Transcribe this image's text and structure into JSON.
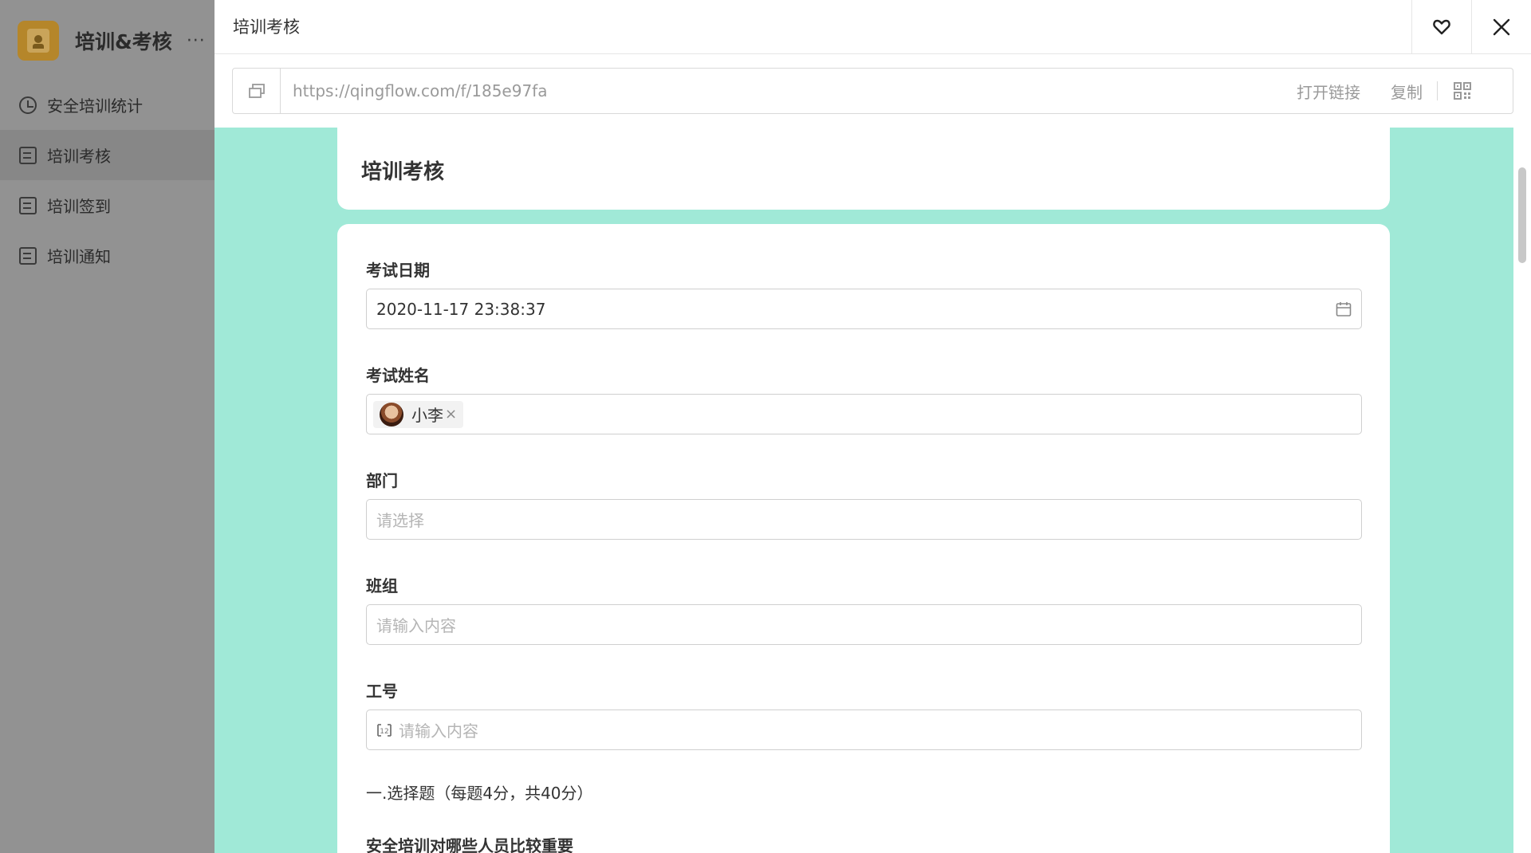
{
  "app": {
    "title": "培训&考核",
    "more": "···"
  },
  "sidebar": {
    "items": [
      {
        "label": "安全培训统计",
        "icon": "clock-icon"
      },
      {
        "label": "培训考核",
        "icon": "form-icon",
        "active": true
      },
      {
        "label": "培训签到",
        "icon": "form-icon"
      },
      {
        "label": "培训通知",
        "icon": "form-icon"
      }
    ]
  },
  "modal": {
    "title": "培训考核",
    "link": {
      "url": "https://qingflow.com/f/185e97fa",
      "open_label": "打开链接",
      "copy_label": "复制"
    }
  },
  "form": {
    "title": "培训考核",
    "fields": {
      "exam_date": {
        "label": "考试日期",
        "value": "2020-11-17 23:38:37"
      },
      "exam_name": {
        "label": "考试姓名",
        "tag": "小李",
        "tag_remove": "×"
      },
      "department": {
        "label": "部门",
        "placeholder": "请选择"
      },
      "team": {
        "label": "班组",
        "placeholder": "请输入内容"
      },
      "employee_id": {
        "label": "工号",
        "placeholder": "请输入内容"
      }
    },
    "section_heading": "一.选择题（每题4分，共40分）",
    "question_1": "安全培训对哪些人员比较重要"
  },
  "colors": {
    "form_background": "#a0e9d7",
    "overlay": "#929292"
  }
}
